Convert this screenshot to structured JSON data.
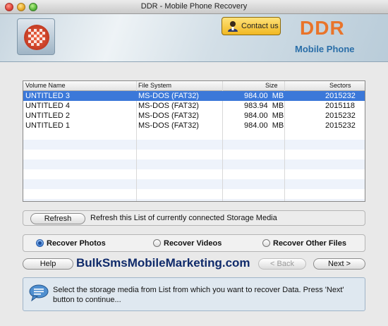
{
  "window": {
    "title": "DDR - Mobile Phone Recovery"
  },
  "header": {
    "brand": "DDR",
    "subtitle": "Mobile Phone",
    "contact_label": "Contact us",
    "colors": {
      "brand": "#e9742a",
      "subtitle": "#2a6ea8"
    }
  },
  "table": {
    "columns": [
      "Volume Name",
      "File System",
      "Size",
      "Sectors"
    ],
    "rows": [
      {
        "name": "UNTITLED 3",
        "fs": "MS-DOS (FAT32)",
        "size": "984.00  MB",
        "sectors": "2015232",
        "selected": true
      },
      {
        "name": "UNTITLED 4",
        "fs": "MS-DOS (FAT32)",
        "size": "983.94  MB",
        "sectors": "2015118",
        "selected": false
      },
      {
        "name": "UNTITLED 2",
        "fs": "MS-DOS (FAT32)",
        "size": "984.00  MB",
        "sectors": "2015232",
        "selected": false
      },
      {
        "name": "UNTITLED 1",
        "fs": "MS-DOS (FAT32)",
        "size": "984.00  MB",
        "sectors": "2015232",
        "selected": false
      }
    ]
  },
  "refresh": {
    "button_label": "Refresh",
    "description": "Refresh this List of currently connected Storage Media"
  },
  "options": {
    "items": [
      {
        "label": "Recover Photos",
        "selected": true
      },
      {
        "label": "Recover Videos",
        "selected": false
      },
      {
        "label": "Recover Other Files",
        "selected": false
      }
    ]
  },
  "footer": {
    "help_label": "Help",
    "watermark": "BulkSmsMobileMarketing.com",
    "back_label": "< Back",
    "next_label": "Next >"
  },
  "info": {
    "icon": "speech-bubble-icon",
    "message": "Select the storage media from List from which you want to recover Data. Press 'Next' button to continue..."
  },
  "colors": {
    "selection": "#3b78d9"
  }
}
